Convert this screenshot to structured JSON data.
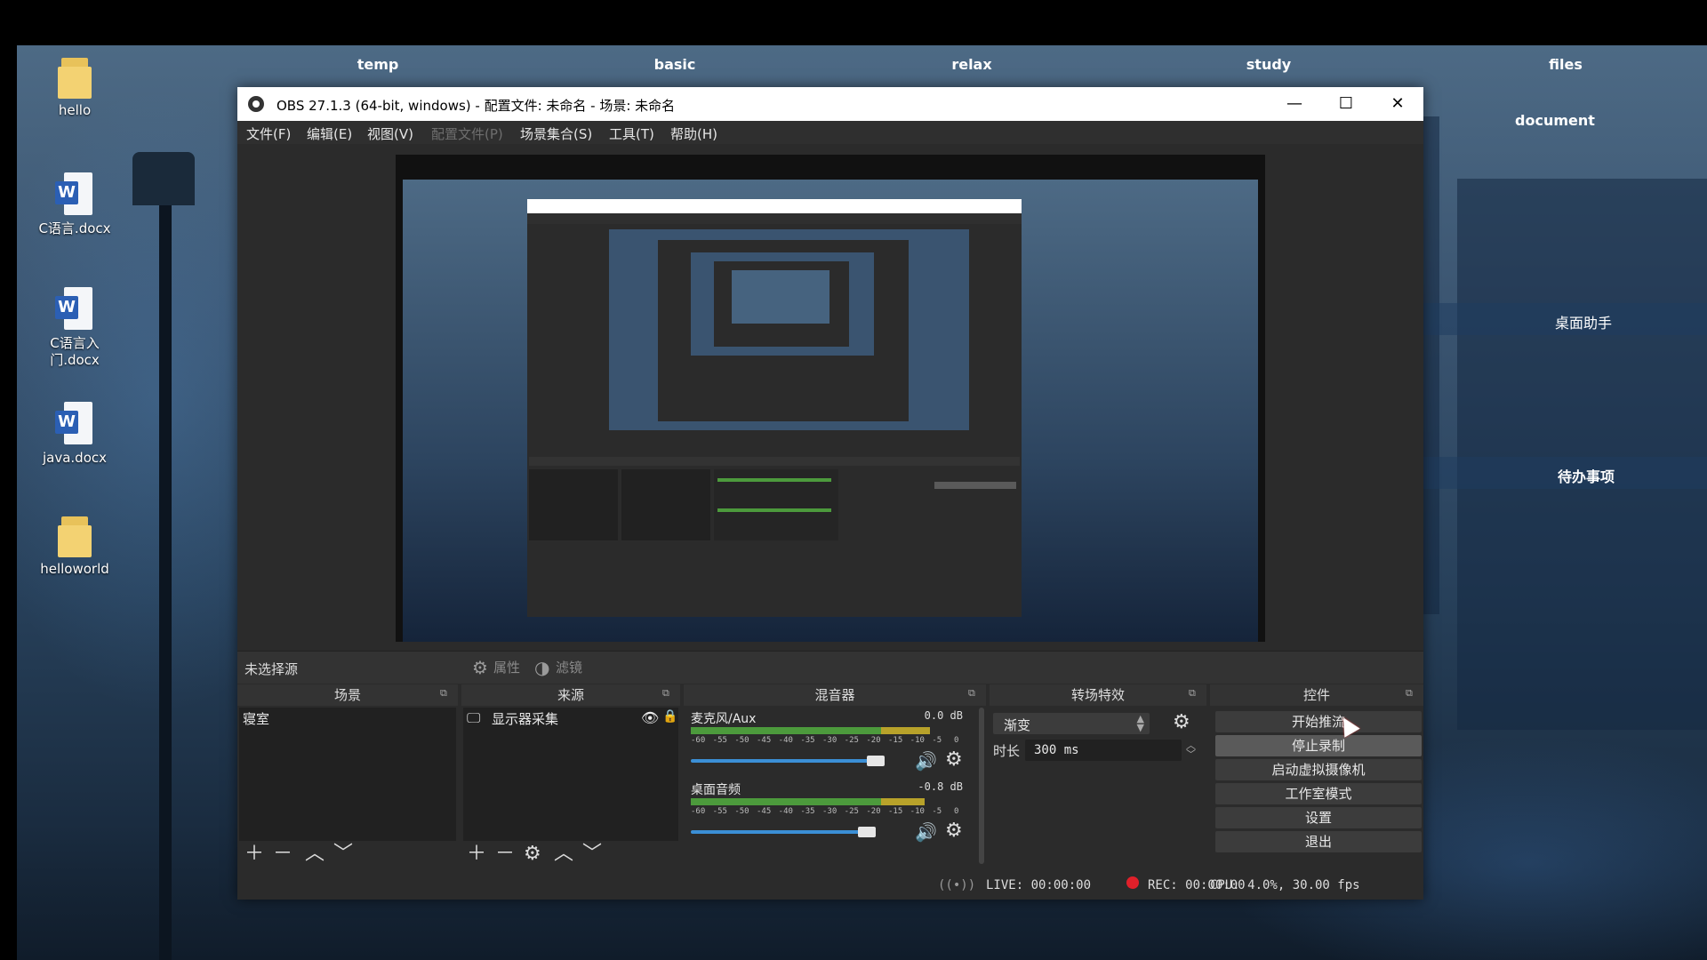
{
  "desktop": {
    "taskbar_groups": [
      "temp",
      "basic",
      "relax",
      "study",
      "files"
    ],
    "side_labels": [
      "document",
      "桌面助手",
      "待办事项"
    ],
    "icons": [
      {
        "label": "hello",
        "type": "folder"
      },
      {
        "label": "C语言.docx",
        "type": "word"
      },
      {
        "label": "C语言入门.docx",
        "type": "word"
      },
      {
        "label": "java.docx",
        "type": "word"
      },
      {
        "label": "helloworld",
        "type": "folder"
      }
    ]
  },
  "window": {
    "title": "OBS 27.1.3 (64-bit, windows) - 配置文件: 未命名 - 场景: 未命名",
    "minimize": "—",
    "maximize": "☐",
    "close": "✕"
  },
  "menu": [
    "文件(F)",
    "编辑(E)",
    "视图(V)",
    "配置文件(P)",
    "场景集合(S)",
    "工具(T)",
    "帮助(H)"
  ],
  "source_toolbar": {
    "no_selection": "未选择源",
    "properties": "属性",
    "filters": "滤镜"
  },
  "docks": {
    "scenes": {
      "title": "场景",
      "items": [
        "寝室"
      ]
    },
    "sources": {
      "title": "来源",
      "items": [
        "显示器采集"
      ]
    },
    "mixer": {
      "title": "混音器",
      "ticks": [
        "-60",
        "-55",
        "-50",
        "-45",
        "-40",
        "-35",
        "-30",
        "-25",
        "-20",
        "-15",
        "-10",
        "-5",
        "0"
      ],
      "channels": [
        {
          "name": "麦克风/Aux",
          "db": "0.0 dB",
          "level": 0.88,
          "volume": 0.88
        },
        {
          "name": "桌面音频",
          "db": "-0.8 dB",
          "level": 0.86,
          "volume": 0.84
        }
      ]
    },
    "transitions": {
      "title": "转场特效",
      "type": "渐变",
      "duration_label": "时长",
      "duration": "300 ms"
    },
    "controls": {
      "title": "控件",
      "buttons": [
        "开始推流",
        "停止录制",
        "启动虚拟摄像机",
        "工作室模式",
        "设置",
        "退出"
      ]
    }
  },
  "status": {
    "live": "LIVE: 00:00:00",
    "rec": "REC: 00:00:00",
    "cpu": "CPU: 4.0%, 30.00 fps"
  },
  "colors": {
    "accent": "#3b8fd6",
    "rec_dot": "#e0202a",
    "meter_green": "#4c9a3c",
    "meter_yellow": "#b8a22a",
    "meter_red": "#b83a2a"
  }
}
